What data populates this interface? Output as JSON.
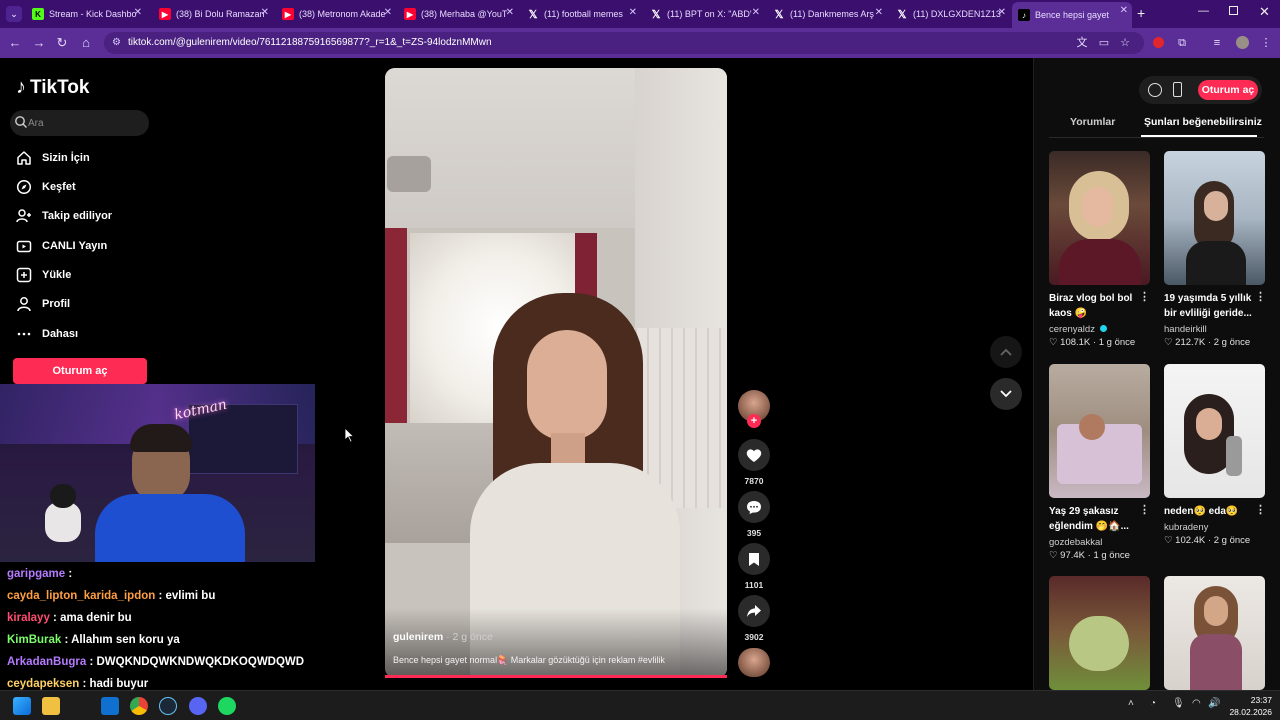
{
  "browser": {
    "tabs": [
      {
        "label": "Stream - Kick Dashbo",
        "icon": "kick"
      },
      {
        "label": "(38) Bi Dolu Ramazan",
        "icon": "youtube"
      },
      {
        "label": "(38) Metronom Akade",
        "icon": "youtube"
      },
      {
        "label": "(38) Merhaba @YouT",
        "icon": "youtube"
      },
      {
        "label": "(11) football memes",
        "icon": "x"
      },
      {
        "label": "(11) BPT on X: \"ABD'",
        "icon": "x"
      },
      {
        "label": "(11) Dankmemes Arş",
        "icon": "x"
      },
      {
        "label": "(11) DXLGXDEN1Z13",
        "icon": "x"
      },
      {
        "label": "Bence hepsi gayet",
        "icon": "tiktok"
      }
    ],
    "url": "tiktok.com/@gulenirem/video/7611218875916569877?_r=1&_t=ZS-94lodznMMwn"
  },
  "sidebar": {
    "logo": "TikTok",
    "search_placeholder": "Ara",
    "items": [
      {
        "label": "Sizin İçin",
        "icon": "home-icon"
      },
      {
        "label": "Keşfet",
        "icon": "compass-icon"
      },
      {
        "label": "Takip ediliyor",
        "icon": "following-icon"
      },
      {
        "label": "CANLI Yayın",
        "icon": "live-icon"
      },
      {
        "label": "Yükle",
        "icon": "upload-icon"
      },
      {
        "label": "Profil",
        "icon": "profile-icon"
      },
      {
        "label": "Dahası",
        "icon": "more-icon"
      }
    ],
    "login": "Oturum aç"
  },
  "webcam": {
    "sign": "kotman"
  },
  "chat": [
    {
      "user": "garipgame",
      "msg": "",
      "color": "#b57bff"
    },
    {
      "user": "cayda_lipton_karida_ipdon",
      "msg": "evlimi bu",
      "color": "#ff9f43"
    },
    {
      "user": "kiralayy",
      "msg": "ama denir bu",
      "color": "#ff4d6d"
    },
    {
      "user": "KimBurak",
      "msg": "Allahım sen koru ya",
      "color": "#7cfc6a"
    },
    {
      "user": "ArkadanBugra",
      "msg": "DWQKNDQWKNDWQKDKOQWDQWD",
      "color": "#b57bff"
    },
    {
      "user": "ceydapeksen",
      "msg": "hadi buyur",
      "color": "#ffd166"
    }
  ],
  "video": {
    "author": "gulenirem",
    "time": "· 2 g önce",
    "caption": "Bence hepsi gayet normal🪼 Markalar gözüktüğü için reklam #evlilik"
  },
  "actions": {
    "likes": "7870",
    "comments": "395",
    "saves": "1101",
    "shares": "3902"
  },
  "right": {
    "login": "Oturum aç",
    "tabs": {
      "comments": "Yorumlar",
      "recommended": "Şunları beğenebilirsiniz"
    },
    "cards": [
      {
        "title": "Biraz vlog bol bol kaos 🤪",
        "user": "cerenyaldz",
        "likes": "108.1K",
        "time": "1 g önce",
        "verified": true
      },
      {
        "title": "19 yaşımda 5 yıllık bir evliliği geride...",
        "user": "handeirkill",
        "likes": "212.7K",
        "time": "2 g önce"
      },
      {
        "title": "Yaş 29 şakasız eğlendim 🤭🏠...",
        "user": "gozdebakkal",
        "likes": "97.4K",
        "time": "1 g önce"
      },
      {
        "title": "neden🥺 eda🥺",
        "user": "kubradeny",
        "likes": "102.4K",
        "time": "2 g önce"
      }
    ]
  },
  "taskbar": {
    "time": "23:37",
    "date": "28.02.2026"
  }
}
